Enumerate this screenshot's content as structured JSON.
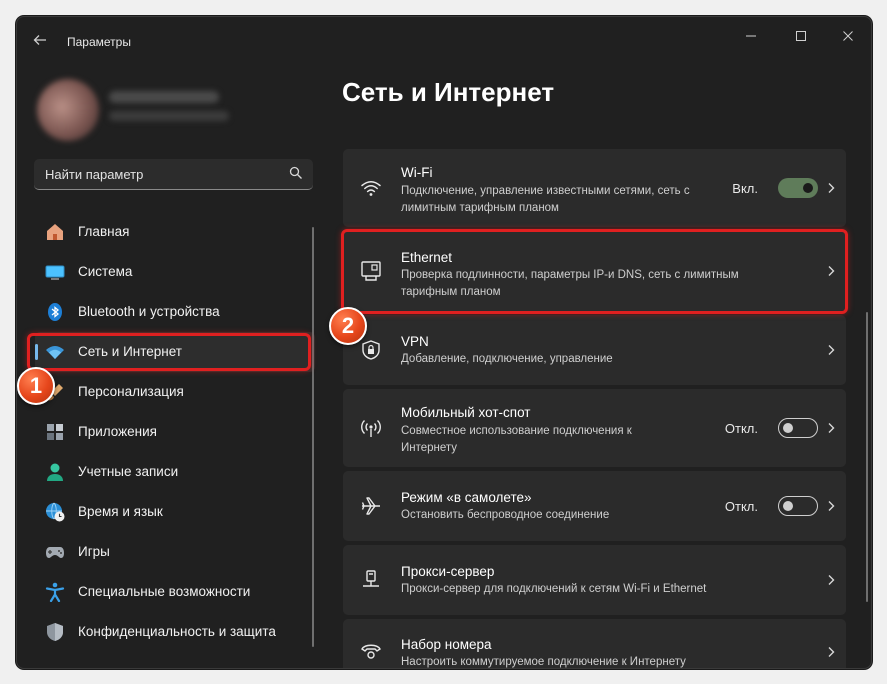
{
  "window": {
    "title": "Параметры"
  },
  "search": {
    "placeholder": "Найти параметр"
  },
  "sidebar": {
    "items": [
      {
        "label": "Главная",
        "icon": "home-icon"
      },
      {
        "label": "Система",
        "icon": "monitor-icon"
      },
      {
        "label": "Bluetooth и устройства",
        "icon": "bluetooth-icon"
      },
      {
        "label": "Сеть и Интернет",
        "icon": "wifi-icon",
        "selected": true
      },
      {
        "label": "Персонализация",
        "icon": "brush-icon"
      },
      {
        "label": "Приложения",
        "icon": "apps-icon"
      },
      {
        "label": "Учетные записи",
        "icon": "person-icon"
      },
      {
        "label": "Время и язык",
        "icon": "globe-clock-icon"
      },
      {
        "label": "Игры",
        "icon": "gamepad-icon"
      },
      {
        "label": "Специальные возможности",
        "icon": "accessibility-icon"
      },
      {
        "label": "Конфиденциальность и защита",
        "icon": "shield-icon"
      }
    ]
  },
  "main": {
    "title": "Сеть и Интернет",
    "cards": [
      {
        "title": "Wi-Fi",
        "desc": "Подключение, управление известными сетями, сеть с лимитным тарифным планом",
        "state": "Вкл.",
        "toggle": "on",
        "icon": "wifi-icon"
      },
      {
        "title": "Ethernet",
        "desc": "Проверка подлинности, параметры IP-и DNS, сеть с лимитным тарифным планом",
        "icon": "ethernet-icon"
      },
      {
        "title": "VPN",
        "desc": "Добавление, подключение, управление",
        "icon": "vpn-shield-icon"
      },
      {
        "title": "Мобильный хот-спот",
        "desc": "Совместное использование подключения к Интернету",
        "state": "Откл.",
        "toggle": "off",
        "icon": "hotspot-icon"
      },
      {
        "title": "Режим «в самолете»",
        "desc": "Остановить беспроводное соединение",
        "state": "Откл.",
        "toggle": "off",
        "icon": "airplane-icon"
      },
      {
        "title": "Прокси-сервер",
        "desc": "Прокси-сервер для подключений к сетям Wi-Fi и Ethernet",
        "icon": "proxy-icon"
      },
      {
        "title": "Набор номера",
        "desc": "Настроить коммутируемое подключение к Интернету",
        "icon": "dialup-icon"
      }
    ]
  },
  "annotations": {
    "badge1": "1",
    "badge2": "2"
  },
  "colors": {
    "accent": "#76b9ed",
    "highlight": "#e02020",
    "badge": "#e6461b",
    "toggle_on": "#5f7c5a"
  }
}
